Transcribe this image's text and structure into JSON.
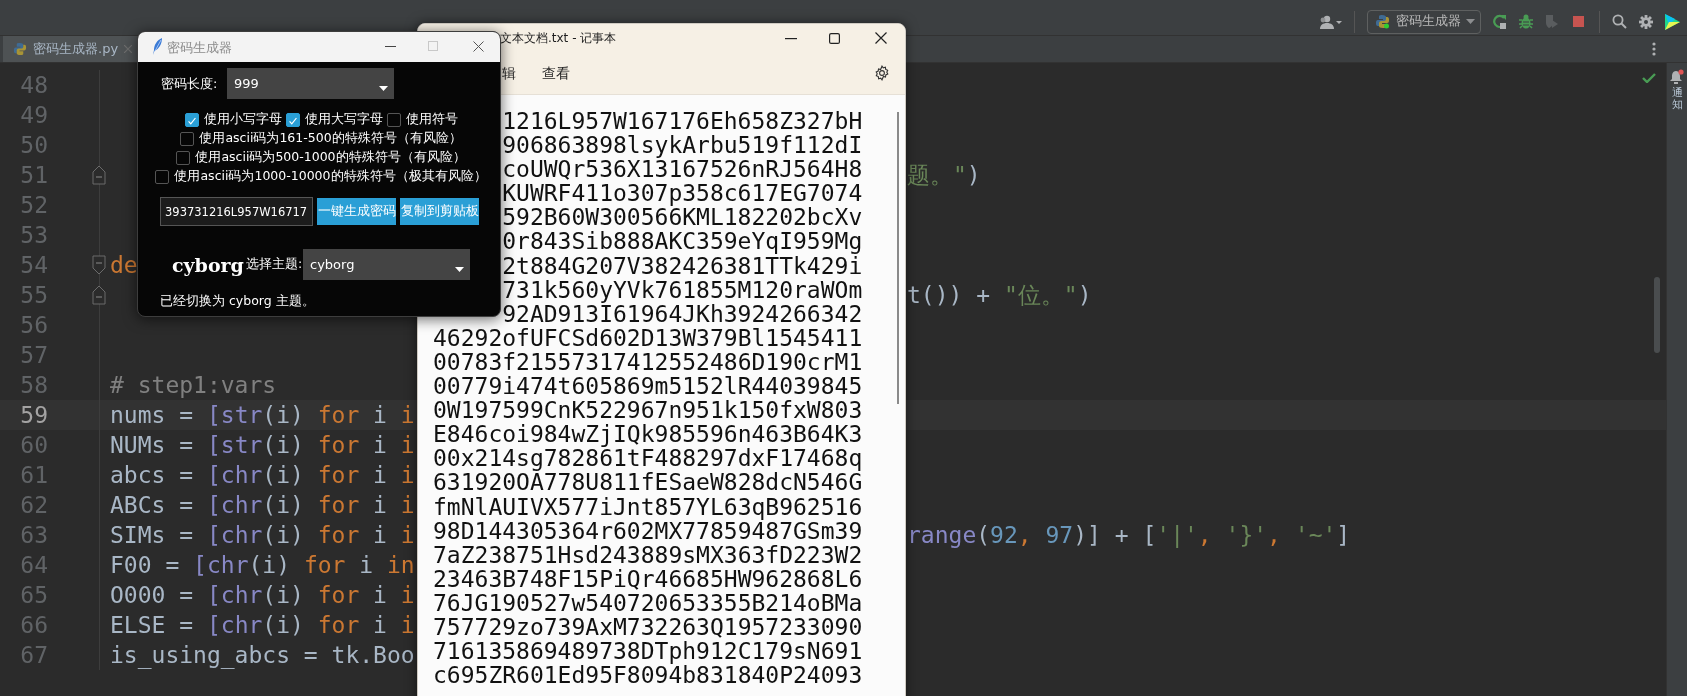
{
  "ide": {
    "toolbar": {
      "run_config": "密码生成器"
    },
    "tabs": [
      {
        "label": "密码生成器.py",
        "selected": true
      }
    ],
    "side_panel_label": "通知",
    "code_lines": [
      {
        "number": "48",
        "current": false,
        "kind": "plain"
      },
      {
        "number": "49",
        "current": false,
        "kind": "plain"
      },
      {
        "number": "50",
        "current": false,
        "kind": "plain"
      },
      {
        "number": "51",
        "current": false,
        "kind": "foldend",
        "right": [
          {
            "text": "题。\"",
            "kind": "string"
          },
          {
            "text": ")",
            "kind": "plain"
          }
        ]
      },
      {
        "number": "52",
        "current": false,
        "kind": "plain"
      },
      {
        "number": "53",
        "current": false,
        "kind": "plain"
      },
      {
        "number": "54",
        "current": false,
        "kind": "foldstart",
        "left": [
          {
            "text": "de",
            "kind": "keyword"
          }
        ]
      },
      {
        "number": "55",
        "current": false,
        "kind": "foldend",
        "right": [
          {
            "text": "t()) + ",
            "kind": "plain"
          },
          {
            "text": "\"位。\"",
            "kind": "string"
          },
          {
            "text": ")",
            "kind": "plain"
          }
        ]
      },
      {
        "number": "56",
        "current": false,
        "kind": "plain"
      },
      {
        "number": "57",
        "current": false,
        "kind": "plain"
      },
      {
        "number": "58",
        "current": false,
        "kind": "plain",
        "left": [
          {
            "text": "# step1:vars",
            "kind": "comment"
          }
        ]
      },
      {
        "number": "59",
        "current": true,
        "kind": "plain",
        "left": [
          {
            "text": "nums = ",
            "kind": "plain"
          },
          {
            "text": "[str",
            "kind": "builtin"
          },
          {
            "text": "(i) ",
            "kind": "plain"
          },
          {
            "text": "for",
            "kind": "keyword"
          },
          {
            "text": " i ",
            "kind": "plain"
          },
          {
            "text": "i",
            "kind": "keyword"
          }
        ]
      },
      {
        "number": "60",
        "current": false,
        "kind": "plain",
        "left": [
          {
            "text": "NUMs = ",
            "kind": "plain"
          },
          {
            "text": "[str",
            "kind": "builtin"
          },
          {
            "text": "(i) ",
            "kind": "plain"
          },
          {
            "text": "for",
            "kind": "keyword"
          },
          {
            "text": " i ",
            "kind": "plain"
          },
          {
            "text": "i",
            "kind": "keyword"
          }
        ]
      },
      {
        "number": "61",
        "current": false,
        "kind": "plain",
        "left": [
          {
            "text": "abcs = ",
            "kind": "plain"
          },
          {
            "text": "[chr",
            "kind": "builtin"
          },
          {
            "text": "(i) ",
            "kind": "plain"
          },
          {
            "text": "for",
            "kind": "keyword"
          },
          {
            "text": " i ",
            "kind": "plain"
          },
          {
            "text": "i",
            "kind": "keyword"
          }
        ]
      },
      {
        "number": "62",
        "current": false,
        "kind": "plain",
        "left": [
          {
            "text": "ABCs = ",
            "kind": "plain"
          },
          {
            "text": "[chr",
            "kind": "builtin"
          },
          {
            "text": "(i) ",
            "kind": "plain"
          },
          {
            "text": "for",
            "kind": "keyword"
          },
          {
            "text": " i ",
            "kind": "plain"
          },
          {
            "text": "i",
            "kind": "keyword"
          }
        ]
      },
      {
        "number": "63",
        "current": false,
        "kind": "plain",
        "left": [
          {
            "text": "SIMs = ",
            "kind": "plain"
          },
          {
            "text": "[chr",
            "kind": "builtin"
          },
          {
            "text": "(i) ",
            "kind": "plain"
          },
          {
            "text": "for",
            "kind": "keyword"
          },
          {
            "text": " i ",
            "kind": "plain"
          },
          {
            "text": "i",
            "kind": "keyword"
          }
        ],
        "right": [
          {
            "text": "range",
            "kind": "builtin"
          },
          {
            "text": "(",
            "kind": "plain"
          },
          {
            "text": "92",
            "kind": "number"
          },
          {
            "text": ", ",
            "kind": "keyword"
          },
          {
            "text": "97",
            "kind": "number"
          },
          {
            "text": ")] + [",
            "kind": "plain"
          },
          {
            "text": "'|'",
            "kind": "string"
          },
          {
            "text": ", ",
            "kind": "keyword"
          },
          {
            "text": "'}'",
            "kind": "string"
          },
          {
            "text": ", ",
            "kind": "keyword"
          },
          {
            "text": "'~'",
            "kind": "string"
          },
          {
            "text": "]",
            "kind": "plain"
          }
        ]
      },
      {
        "number": "64",
        "current": false,
        "kind": "plain",
        "left": [
          {
            "text": "F00 = ",
            "kind": "plain"
          },
          {
            "text": "[chr",
            "kind": "builtin"
          },
          {
            "text": "(i) ",
            "kind": "plain"
          },
          {
            "text": "for",
            "kind": "keyword"
          },
          {
            "text": " i ",
            "kind": "plain"
          },
          {
            "text": "in",
            "kind": "keyword"
          }
        ]
      },
      {
        "number": "65",
        "current": false,
        "kind": "plain",
        "left": [
          {
            "text": "O000 = ",
            "kind": "plain"
          },
          {
            "text": "[chr",
            "kind": "builtin"
          },
          {
            "text": "(i) ",
            "kind": "plain"
          },
          {
            "text": "for",
            "kind": "keyword"
          },
          {
            "text": " i ",
            "kind": "plain"
          },
          {
            "text": "i",
            "kind": "keyword"
          }
        ]
      },
      {
        "number": "66",
        "current": false,
        "kind": "plain",
        "left": [
          {
            "text": "ELSE = ",
            "kind": "plain"
          },
          {
            "text": "[chr",
            "kind": "builtin"
          },
          {
            "text": "(i) ",
            "kind": "plain"
          },
          {
            "text": "for",
            "kind": "keyword"
          },
          {
            "text": " i ",
            "kind": "plain"
          },
          {
            "text": "i",
            "kind": "keyword"
          }
        ]
      },
      {
        "number": "67",
        "current": false,
        "kind": "plain",
        "left": [
          {
            "text": "is_using_abcs = tk.Boo",
            "kind": "plain"
          }
        ]
      }
    ]
  },
  "notepad": {
    "title": "文本文档.txt - 记事本",
    "menu": [
      "辑",
      "查看"
    ],
    "lines": [
      "1216L957W167176Eh658Z327bH",
      "906863898lsykArbu519f112dI",
      "coUWQr536X13167526nRJ564H8",
      "KUWRF411o307p358c617EG7074",
      "592B60W300566KML182202bcXv",
      "0r843Sib888AKC359eYqI959Mg",
      "2t884G207V382426381TTk429i",
      "731k560yYVk761855M120raWOm",
      "92AD913I61964JKh3924266342",
      "46292ofUFCSd602D13W379Bl1545411",
      "00783f21557317412552486D190crM1",
      "00779i474t605869m5152lR44039845",
      "0W197599CnK522967n951k150fxW803",
      "E846coi984wZjIQk985596n463B64K3",
      "00x214sg782861tF488297dxF17468q",
      "631920OA778U811fESaeW828dcN546G",
      "fmNlAUIVX577iJnt857YL63qB962516",
      "98D144305364r602MX77859487GSm39",
      "7aZ238751Hsd243889sMX363fD223W2",
      "23463B748F15PiQr46685HW962868L6",
      "76JG190527w540720653355B214oBMa",
      "757729zo739AxM732263Q1957233090",
      "716135869489738DTph912C179sN691",
      "c695ZR601Ed95F8094b831840P24093"
    ]
  },
  "password_window": {
    "title": "密码生成器",
    "length_label": "密码长度:",
    "length_value": "999",
    "option_rows": [
      [
        {
          "label": "使用小写字母",
          "checked": true
        },
        {
          "label": "使用大写字母",
          "checked": true
        },
        {
          "label": "使用符号",
          "checked": false
        }
      ],
      [
        {
          "label": "使用ascii码为161-500的特殊符号（有风险）",
          "checked": false
        }
      ],
      [
        {
          "label": "使用ascii码为500-1000的特殊符号（有风险）",
          "checked": false
        }
      ],
      [
        {
          "label": "使用ascii码为1000-10000的特殊符号（极其有风险）",
          "checked": false
        }
      ]
    ],
    "password": "393731216L957W16717",
    "buttons": [
      "一键生成密码",
      "复制到剪贴板"
    ],
    "theme_name": "cyborg",
    "theme_label": "选择主题:",
    "theme_value": "cyborg",
    "status": "已经切换为 cyborg 主题。"
  }
}
